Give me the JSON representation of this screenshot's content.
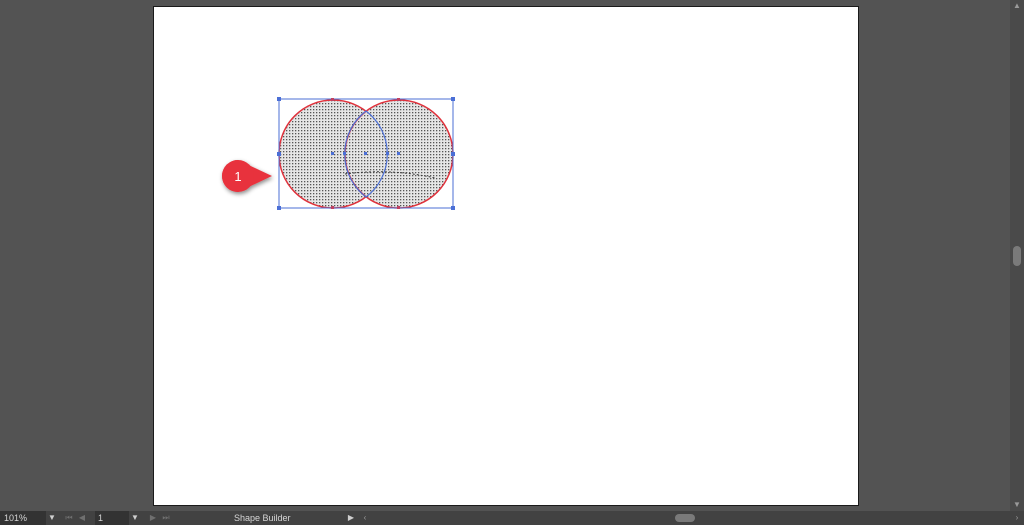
{
  "statusbar": {
    "zoom": "101%",
    "page": "1",
    "tool": "Shape Builder"
  },
  "icons": {
    "dropdown": "▼",
    "first": "⏮",
    "prev": "◀",
    "next": "▶",
    "last": "⏭",
    "menu": "▶",
    "scroll_left": "‹",
    "scroll_right": "›",
    "scroll_up": "▲",
    "scroll_down": "▼"
  },
  "callout": {
    "number": "1",
    "color": "#e8323c"
  },
  "colors": {
    "selection": "#4b6fd6",
    "shape_stroke": "#e0323c",
    "pasteboard": "#535353",
    "artboard": "#ffffff"
  }
}
